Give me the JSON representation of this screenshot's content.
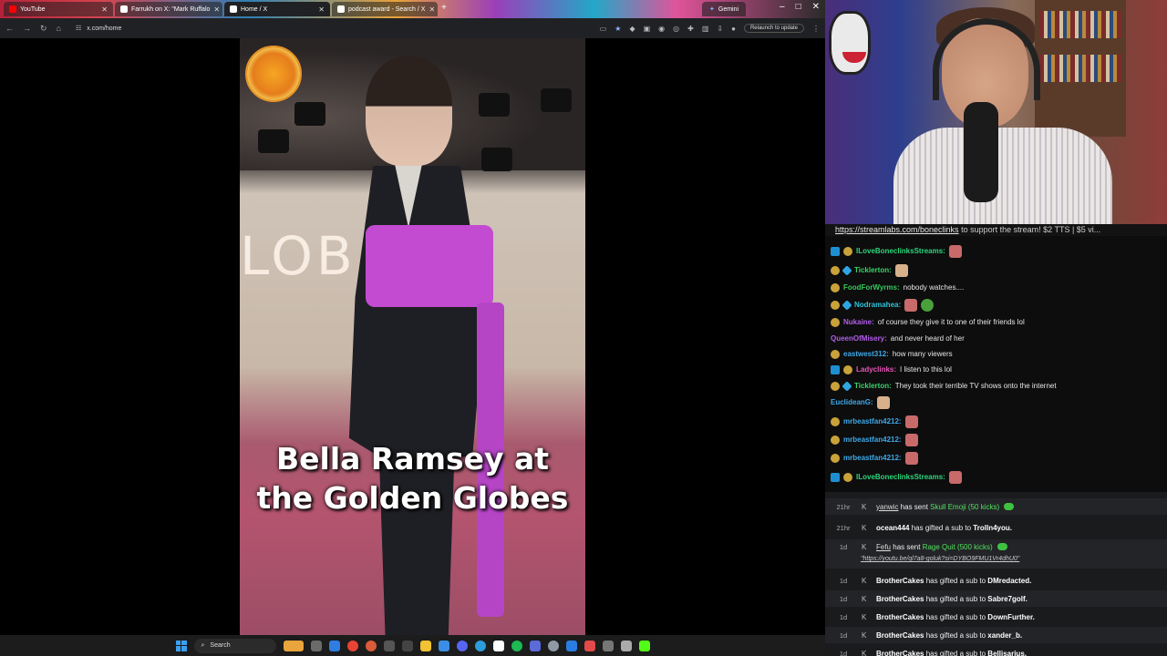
{
  "browser": {
    "tabs": [
      {
        "label": "YouTube",
        "favicon_color": "#ff0000"
      },
      {
        "label": "Farrukh on X: \"Mark Ruffalo",
        "favicon_color": "#ffffff"
      },
      {
        "label": "Home / X",
        "favicon_color": "#ffffff"
      },
      {
        "label": "podcast award - Search / X",
        "favicon_color": "#ffffff"
      }
    ],
    "extra_tab": "Gemini",
    "new_tab": "+",
    "window_controls": {
      "minimize": "–",
      "maximize": "□",
      "close": "✕"
    },
    "url": "x.com/home",
    "relaunch_label": "Relaunch to update"
  },
  "video": {
    "caption_line1": "Bella Ramsey at",
    "caption_line2": "the Golden Globes",
    "wall_text": "LOB"
  },
  "taskbar": {
    "search_label": "Search"
  },
  "stream": {
    "ticker_link": "https://streamlabs.com/boneclinks",
    "ticker_text": " to support the stream! $2 TTS | $5 vi..."
  },
  "chat": [
    {
      "user": "ILoveBoneclinksStreams:",
      "color": "#2bd67b",
      "text": "",
      "badges": [
        "kick",
        "sub"
      ],
      "emotes": [
        "emote"
      ]
    },
    {
      "user": "Ticklerton:",
      "color": "#3ad36b",
      "text": "",
      "badges": [
        "sub",
        "vip"
      ],
      "emotes": [
        "face"
      ]
    },
    {
      "user": "FoodForWyrms:",
      "color": "#35c85c",
      "text": "nobody watches....",
      "badges": [
        "sub"
      ],
      "emotes": []
    },
    {
      "user": "Nodramahea:",
      "color": "#2ec3d8",
      "text": "",
      "badges": [
        "sub",
        "vip"
      ],
      "emotes": [
        "emote",
        "green"
      ]
    },
    {
      "user": "Nukaine:",
      "color": "#b15de8",
      "text": "of course they give it to one of their friends lol",
      "badges": [
        "sub"
      ],
      "emotes": []
    },
    {
      "user": "QueenOfMisery:",
      "color": "#b15de8",
      "text": "and never heard of her",
      "badges": [],
      "emotes": []
    },
    {
      "user": "eastwest312:",
      "color": "#3fa8e8",
      "text": "how many viewers",
      "badges": [
        "sub"
      ],
      "emotes": []
    },
    {
      "user": "Ladyclinks:",
      "color": "#e855b8",
      "text": "I listen to this lol",
      "badges": [
        "kick",
        "sub"
      ],
      "emotes": []
    },
    {
      "user": "Ticklerton:",
      "color": "#3ad36b",
      "text": "They took their terrible TV shows onto the internet",
      "badges": [
        "sub",
        "vip"
      ],
      "emotes": []
    },
    {
      "user": "EuclideanG:",
      "color": "#3fa8e8",
      "text": "",
      "badges": [],
      "emotes": [
        "face"
      ]
    },
    {
      "user": "mrbeastfan4212:",
      "color": "#3fa8e8",
      "text": "",
      "badges": [
        "sub"
      ],
      "emotes": [
        "emote"
      ]
    },
    {
      "user": "mrbeastfan4212:",
      "color": "#3fa8e8",
      "text": "",
      "badges": [
        "sub"
      ],
      "emotes": [
        "emote"
      ]
    },
    {
      "user": "mrbeastfan4212:",
      "color": "#3fa8e8",
      "text": "",
      "badges": [
        "sub"
      ],
      "emotes": [
        "emote"
      ]
    },
    {
      "user": "ILoveBoneclinksStreams:",
      "color": "#2bd67b",
      "text": "",
      "badges": [
        "kick",
        "sub"
      ],
      "emotes": [
        "emote"
      ]
    }
  ],
  "events": [
    {
      "time": "21hr",
      "name": "yanwic",
      "underline": true,
      "action": "has sent",
      "gift": "Skull Emoji (50 kicks)",
      "target": "",
      "coin": true
    },
    {
      "time": "21hr",
      "name": "ocean444",
      "underline": false,
      "action": "has gifted a sub to",
      "gift": "",
      "target": "Trolln4you.",
      "coin": false
    },
    {
      "time": "1d",
      "name": "Fefu",
      "underline": true,
      "action": "has sent",
      "gift": "Rage Quit (500 kicks)",
      "target": "",
      "coin": true,
      "link": "\"https://youtu.be/ql7a8-goluk?si=DYBO9FMU1Vr4dhU0\""
    },
    {
      "time": "1d",
      "name": "BrotherCakes",
      "underline": false,
      "action": "has gifted a sub to",
      "gift": "",
      "target": "DMredacted.",
      "coin": false
    },
    {
      "time": "1d",
      "name": "BrotherCakes",
      "underline": false,
      "action": "has gifted a sub to",
      "gift": "",
      "target": "Sabre7golf.",
      "coin": false
    },
    {
      "time": "1d",
      "name": "BrotherCakes",
      "underline": false,
      "action": "has gifted a sub to",
      "gift": "",
      "target": "DownFurther.",
      "coin": false
    },
    {
      "time": "1d",
      "name": "BrotherCakes",
      "underline": false,
      "action": "has gifted a sub to",
      "gift": "",
      "target": "xander_b.",
      "coin": false
    },
    {
      "time": "1d",
      "name": "BrotherCakes",
      "underline": false,
      "action": "has gifted a sub to",
      "gift": "",
      "target": "Bellisarius.",
      "coin": false
    }
  ]
}
